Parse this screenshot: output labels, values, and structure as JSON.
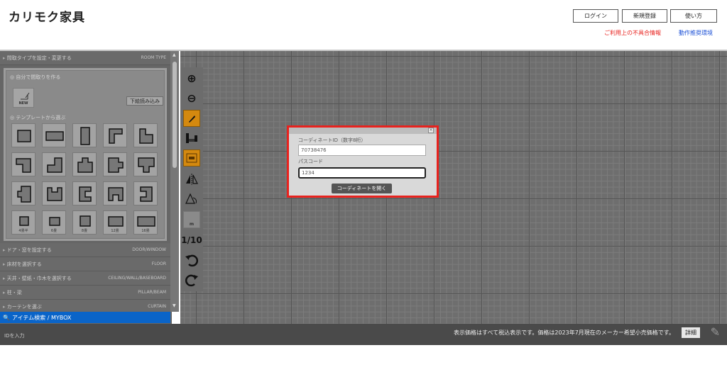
{
  "header": {
    "logo": "カリモク家具",
    "login": "ログイン",
    "register": "新規登録",
    "howto": "使い方",
    "issues_link": "ご利用上の不具合情報",
    "env_link": "動作推奨環境"
  },
  "sections": {
    "room_type": {
      "label": "間取タイプを設定・変更する",
      "en": "ROOM TYPE"
    },
    "door": {
      "label": "ドア・窓を設定する",
      "en": "DOOR/WINDOW"
    },
    "floor": {
      "label": "床材を選択する",
      "en": "FLOOR"
    },
    "ceiling": {
      "label": "天井・壁紙・巾木を選択する",
      "en": "CEILING/WALL/BASEBOARD"
    },
    "pillar": {
      "label": "柱・梁",
      "en": "PILLAR/BEAM"
    },
    "curtain": {
      "label": "カーテンを選ぶ",
      "en": "CURTAIN"
    }
  },
  "room_panel": {
    "make_own": "自分で間取りを作る",
    "new_label": "NEW",
    "trace_button": "下絵読み込み",
    "from_template": "テンプレートから選ぶ",
    "size_labels": [
      "4畳半",
      "6畳",
      "8畳",
      "12畳",
      "16畳"
    ]
  },
  "search": {
    "label": "アイテム検索 / MYBOX"
  },
  "toolbar": {
    "zoom_in": "⊕",
    "zoom_out": "⊖",
    "scale": "1/10",
    "unit": "m"
  },
  "dialog": {
    "id_label": "コーディネートID（数字8桁）",
    "id_value": "70738476",
    "pass_label": "パスコード",
    "pass_value": "1234",
    "open_button": "コーディネートを開く",
    "close": "×"
  },
  "footer": {
    "id_input": "IDを入力",
    "note": "表示価格はすべて税込表示です。価格は2023年7月現在のメーカー希望小売価格です。",
    "detail": "詳細"
  },
  "colors": {
    "accent_red": "#e8221e",
    "link_blue": "#1a4fd6",
    "search_blue": "#0a64c8",
    "tool_orange": "#d4890f"
  }
}
